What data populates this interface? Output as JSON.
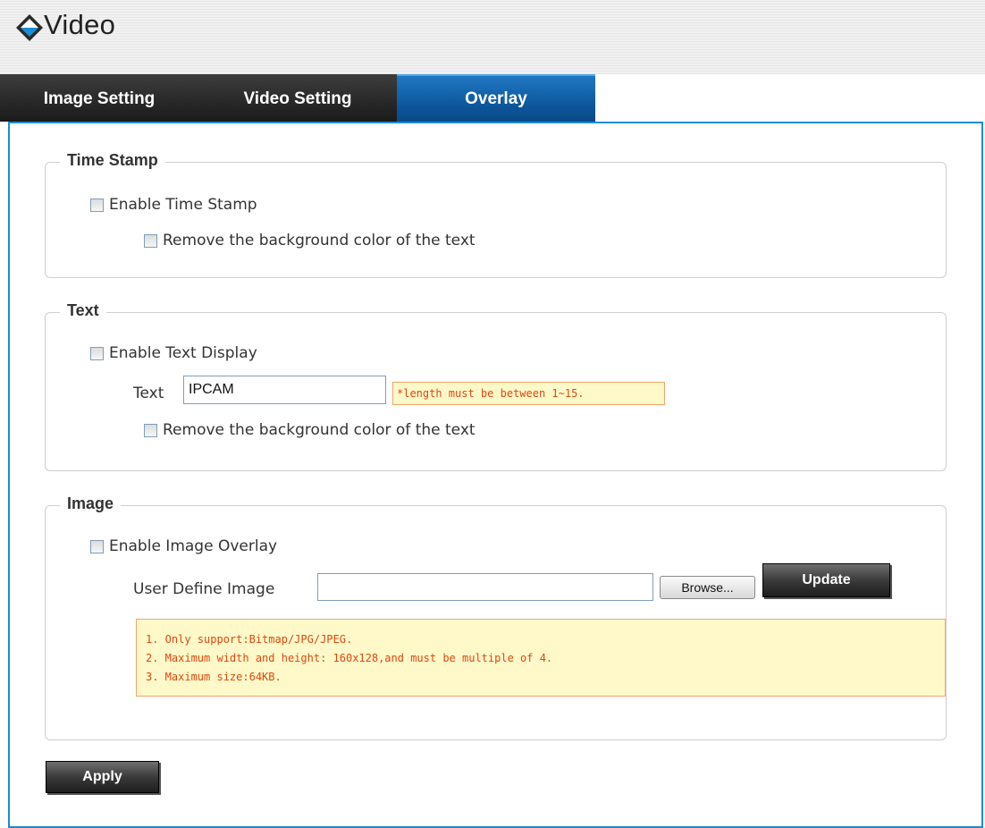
{
  "header": {
    "title": "Video",
    "logo_icon": "diamond-arrow-icon"
  },
  "tabs": [
    {
      "label": "Image Setting",
      "active": false
    },
    {
      "label": "Video Setting",
      "active": false
    },
    {
      "label": "Overlay",
      "active": true
    }
  ],
  "time_stamp": {
    "legend": "Time Stamp",
    "enable_label": "Enable Time Stamp",
    "remove_bg_label": "Remove the background color of the text"
  },
  "text": {
    "legend": "Text",
    "enable_label": "Enable Text Display",
    "text_label": "Text",
    "text_value": "IPCAM",
    "hint": "*length must be between 1~15.",
    "remove_bg_label": "Remove the background color of the text"
  },
  "image": {
    "legend": "Image",
    "enable_label": "Enable Image Overlay",
    "user_image_label": "User Define Image",
    "file_value": "",
    "browse_label": "Browse...",
    "update_label": "Update",
    "notes": [
      "1. Only support:Bitmap/JPG/JPEG.",
      "2. Maximum width and height: 160x128,and must be multiple of 4.",
      "3. Maximum size:64KB."
    ]
  },
  "apply_label": "Apply",
  "colors": {
    "accent": "#1d8bd6",
    "hint_text": "#e0470e",
    "hint_bg": "#fff9c9"
  }
}
